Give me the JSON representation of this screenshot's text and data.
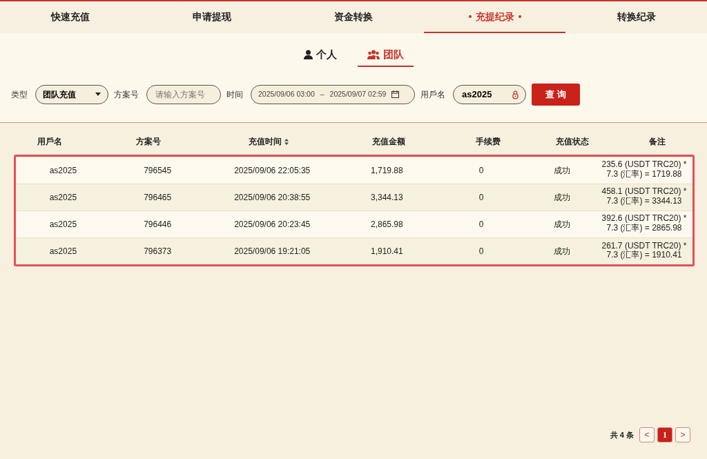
{
  "tabs": [
    {
      "label": "快速充值",
      "selected": false
    },
    {
      "label": "申请提现",
      "selected": false
    },
    {
      "label": "资金转换",
      "selected": false
    },
    {
      "label": "充提纪录",
      "selected": true
    },
    {
      "label": "转换纪录",
      "selected": false
    }
  ],
  "scope_tabs": [
    {
      "label": "个人",
      "kind": "person",
      "selected": false
    },
    {
      "label": "团队",
      "kind": "team",
      "selected": true
    }
  ],
  "filters": {
    "type": {
      "label": "类型",
      "value": "团队充值"
    },
    "plan": {
      "label": "方案号",
      "placeholder": "请输入方案号"
    },
    "time": {
      "label": "时间",
      "start": "2025/09/06 03:00",
      "separator": "–",
      "end": "2025/09/07 02:59"
    },
    "username": {
      "label": "用戶名",
      "value": "as2025"
    },
    "search_button": "查 询"
  },
  "table": {
    "columns": [
      "用戶名",
      "方案号",
      "充值时间",
      "充值金额",
      "手续费",
      "充值状态",
      "备注"
    ],
    "rows": [
      [
        "as2025",
        "796545",
        "2025/09/06 22:05:35",
        "1,719.88",
        "0",
        "成功",
        "235.6 (USDT TRC20) * 7.3 (汇率) = 1719.88"
      ],
      [
        "as2025",
        "796465",
        "2025/09/06 20:38:55",
        "3,344.13",
        "0",
        "成功",
        "458.1 (USDT TRC20) * 7.3 (汇率) = 3344.13"
      ],
      [
        "as2025",
        "796446",
        "2025/09/06 20:23:45",
        "2,865.98",
        "0",
        "成功",
        "392.6 (USDT TRC20) * 7.3 (汇率) = 2865.98"
      ],
      [
        "as2025",
        "796373",
        "2025/09/06 19:21:05",
        "1,910.41",
        "0",
        "成功",
        "261.7 (USDT TRC20) * 7.3 (汇率) = 1910.41"
      ]
    ]
  },
  "pagination": {
    "total": "共 4 条",
    "prev": "<",
    "pages": [
      {
        "label": "1",
        "selected": true
      }
    ],
    "next": ">"
  }
}
